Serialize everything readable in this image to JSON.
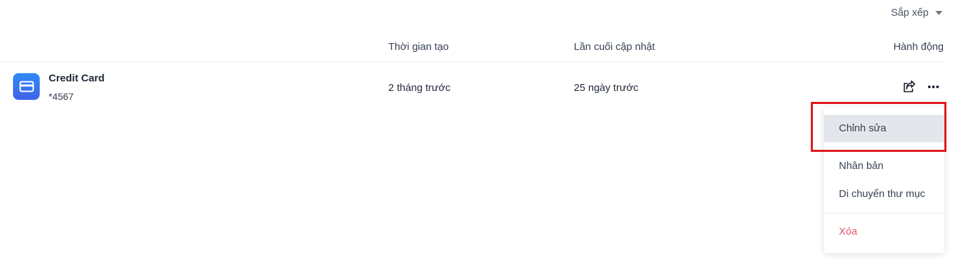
{
  "toolbar": {
    "sort_label": "Sắp xếp",
    "sort_icon": "caret-down-icon"
  },
  "table": {
    "headers": {
      "created": "Thời gian tạo",
      "updated": "Lần cuối cập nhật",
      "actions": "Hành động"
    },
    "rows": [
      {
        "icon": "credit-card-icon",
        "title": "Credit Card",
        "subtitle": "*4567",
        "created": "2 tháng trước",
        "updated": "25 ngày trước",
        "action_icons": [
          "share-icon",
          "more-icon"
        ]
      }
    ]
  },
  "menu": {
    "items": [
      {
        "label": "Chỉnh sửa",
        "state": "hover"
      },
      {
        "label": "Nhân bản"
      },
      {
        "label": "Di chuyển thư mục"
      },
      {
        "label": "Xóa",
        "color": "#e0566b"
      }
    ]
  },
  "colors": {
    "icon_gradient_top": "#2f8bf5",
    "icon_gradient_bottom": "#3f63ea",
    "highlight": "#e0161b",
    "menu_hover_bg": "#e3e6eb"
  }
}
